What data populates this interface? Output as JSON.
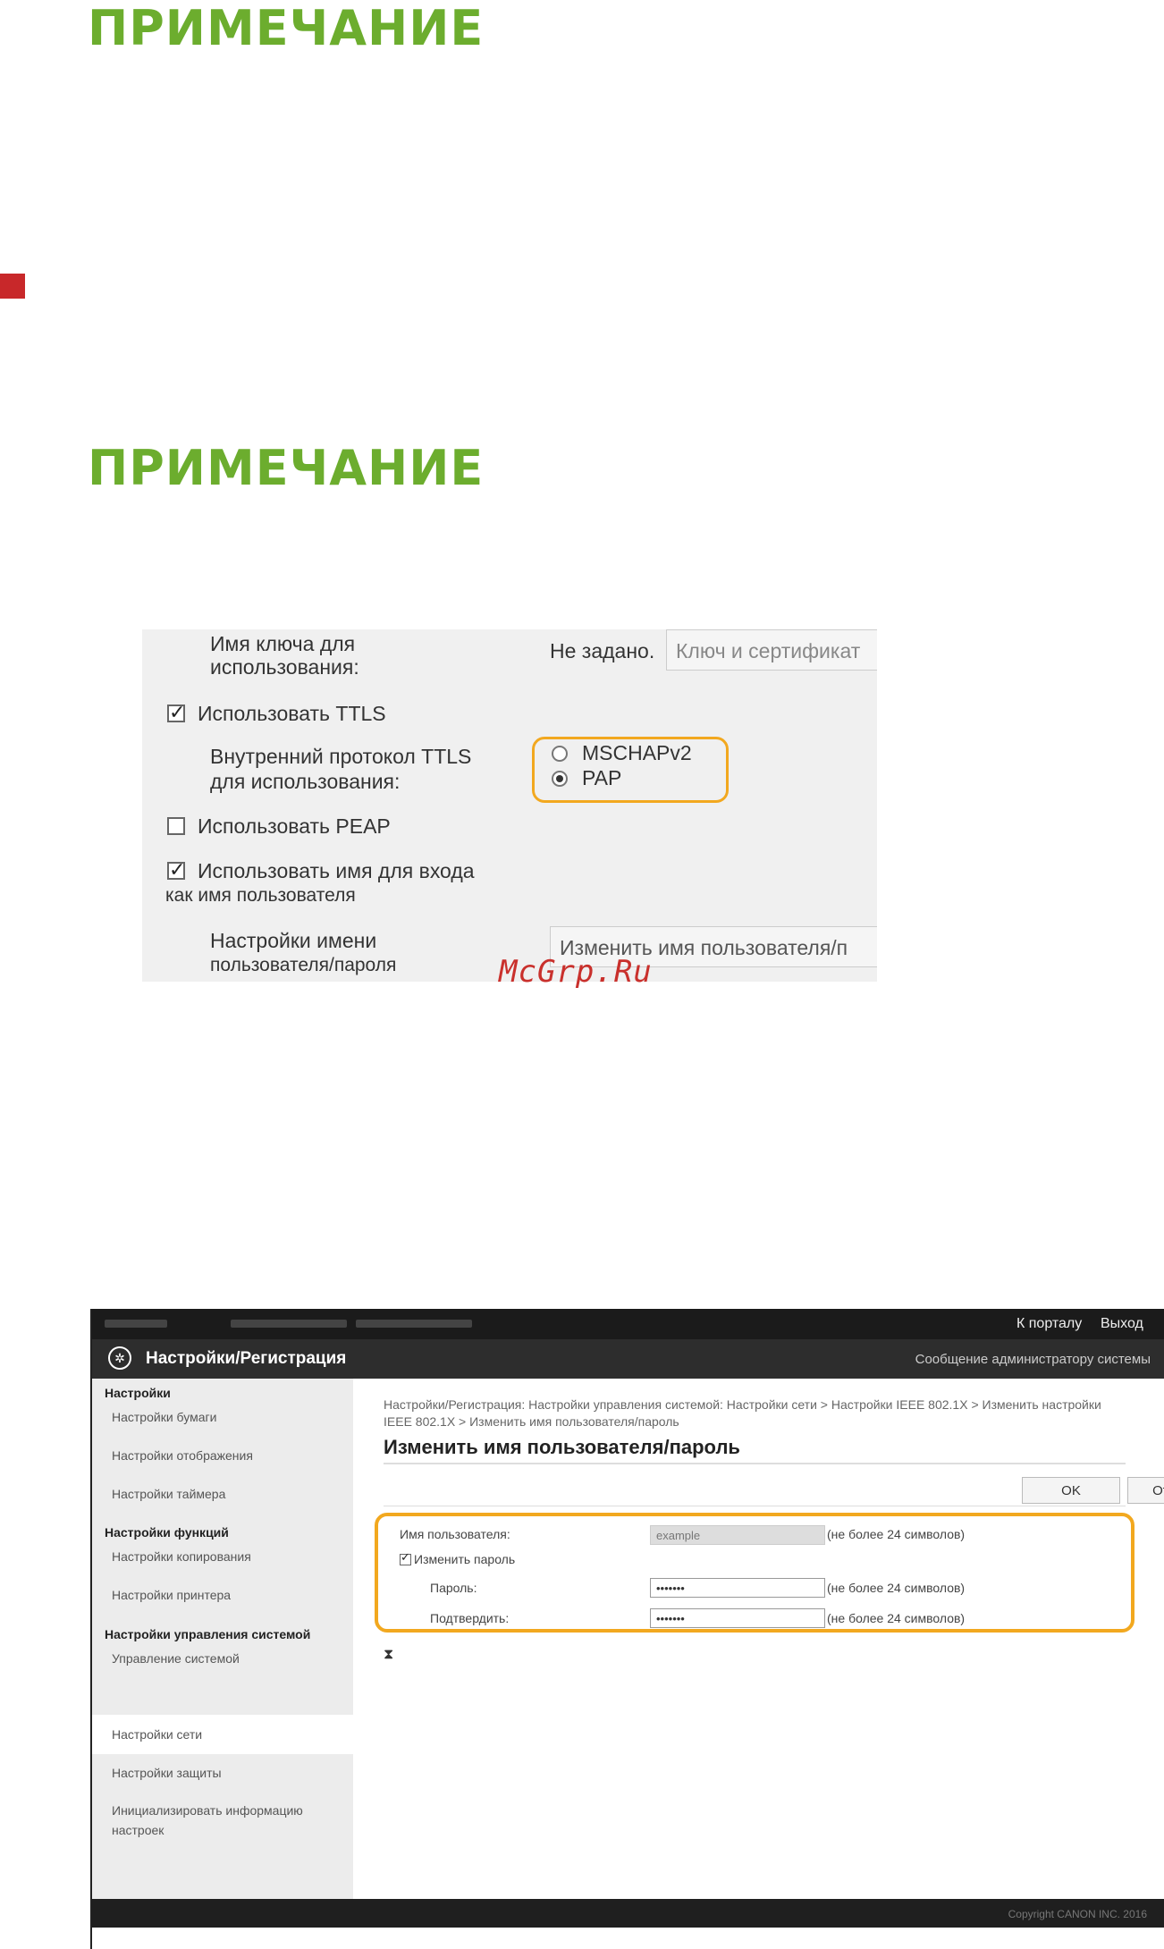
{
  "notes": [
    "ПРИМЕЧАНИЕ",
    "ПРИМЕЧАНИЕ"
  ],
  "watermark": "McGrp.Ru",
  "eap_settings": {
    "key_label_line1": "Имя ключа для",
    "key_label_line2": "использования:",
    "key_value": "Не задано.",
    "key_button": "Ключ и сертификат",
    "use_ttls": "Использовать TTLS",
    "ttls_protocol_line1": "Внутренний протокол TTLS",
    "ttls_protocol_line2": "для использования:",
    "radio_mschap": "MSCHAPv2",
    "radio_pap": "PAP",
    "use_peap": "Использовать PEAP",
    "use_login_line1": "Использовать имя для входа",
    "use_login_line2": "как имя пользователя",
    "user_settings_line1": "Настройки имени",
    "user_settings_line2": "пользователя/пароля",
    "user_settings_button": "Изменить имя пользователя/п"
  },
  "remote_ui": {
    "to_portal": "К порталу",
    "logout": "Выход",
    "app_title": "Настройки/Регистрация",
    "admin_message": "Сообщение администратору системы",
    "sidebar": {
      "cat_settings": "Настройки",
      "paper": "Настройки бумаги",
      "display": "Настройки отображения",
      "timer": "Настройки таймера",
      "cat_functions": "Настройки функций",
      "copy": "Настройки копирования",
      "printer": "Настройки принтера",
      "cat_system": "Настройки управления системой",
      "system_mgmt": "Управление системой",
      "network": "Настройки сети",
      "security": "Настройки защиты",
      "init_info": "Инициализировать информацию настроек"
    },
    "breadcrumb": "Настройки/Регистрация: Настройки управления системой: Настройки сети > Настройки IEEE 802.1X > Изменить настройки IEEE 802.1X > Изменить имя пользователя/пароль",
    "page_title": "Изменить имя пользователя/пароль",
    "ok": "OK",
    "cancel": "Отмена",
    "username_label": "Имя пользователя:",
    "username_value": "example",
    "hint": "(не более 24 символов)",
    "change_password": "Изменить пароль",
    "password_label": "Пароль:",
    "password_value": "•••••••",
    "confirm_label": "Подтвердить:",
    "confirm_value": "•••••••",
    "to_top": "⧗",
    "copyright": "Copyright CANON INC. 2016"
  },
  "colors": {
    "note_green": "#6cad2e",
    "highlight_orange": "#f2a81f",
    "marker_red": "#c8282a"
  }
}
